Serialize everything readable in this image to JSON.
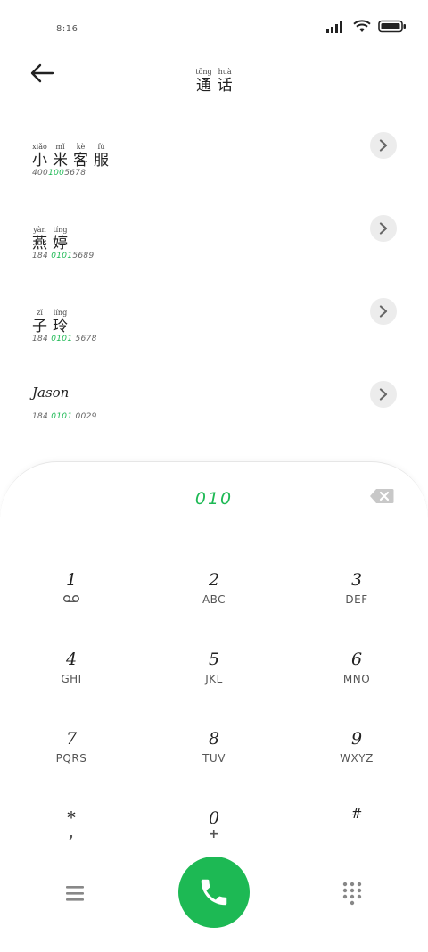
{
  "status_bar": {
    "time": "8:16"
  },
  "header": {
    "title": [
      {
        "pinyin": "tōng",
        "char": "通"
      },
      {
        "pinyin": "huà",
        "char": "话"
      }
    ]
  },
  "contacts": [
    {
      "name": [
        {
          "pinyin": "xiǎo",
          "char": "小"
        },
        {
          "pinyin": "mǐ",
          "char": "米"
        },
        {
          "pinyin": "kè",
          "char": "客"
        },
        {
          "pinyin": "fú",
          "char": "服"
        }
      ],
      "number": {
        "before": "400",
        "match": "100",
        "after": "5678"
      }
    },
    {
      "name": [
        {
          "pinyin": "yàn",
          "char": "燕"
        },
        {
          "pinyin": "tíng",
          "char": "婷"
        }
      ],
      "number": {
        "before": "184 ",
        "match": "0101",
        "after": "5689"
      }
    },
    {
      "name": [
        {
          "pinyin": "zǐ",
          "char": "子"
        },
        {
          "pinyin": "líng",
          "char": "玲"
        }
      ],
      "number": {
        "before": "184 ",
        "match": "0101",
        "after": " 5678"
      }
    },
    {
      "name_plain": "Jason",
      "number": {
        "before": "184 ",
        "match": "0101",
        "after": " 0029"
      }
    }
  ],
  "dialer": {
    "input": "010",
    "keys": [
      {
        "digit": "1",
        "letters": "ꝏ"
      },
      {
        "digit": "2",
        "letters": "ABC"
      },
      {
        "digit": "3",
        "letters": "DEF"
      },
      {
        "digit": "4",
        "letters": "GHI"
      },
      {
        "digit": "5",
        "letters": "JKL"
      },
      {
        "digit": "6",
        "letters": "MNO"
      },
      {
        "digit": "7",
        "letters": "PQRS"
      },
      {
        "digit": "8",
        "letters": "TUV"
      },
      {
        "digit": "9",
        "letters": "WXYZ"
      },
      {
        "digit": "*",
        "letters": ","
      },
      {
        "digit": "0",
        "letters": "+"
      },
      {
        "digit": "#",
        "letters": ""
      }
    ]
  },
  "colors": {
    "accent": "#1db954",
    "chevron_bg": "#ececec"
  },
  "icons": {
    "back": "arrow-left-icon",
    "chevron": "chevron-right-icon",
    "backspace": "backspace-icon",
    "menu": "hamburger-menu-icon",
    "call": "phone-icon",
    "keypad": "keypad-icon",
    "voicemail": "voicemail-icon",
    "signal": "signal-icon",
    "wifi": "wifi-icon",
    "battery": "battery-icon"
  }
}
